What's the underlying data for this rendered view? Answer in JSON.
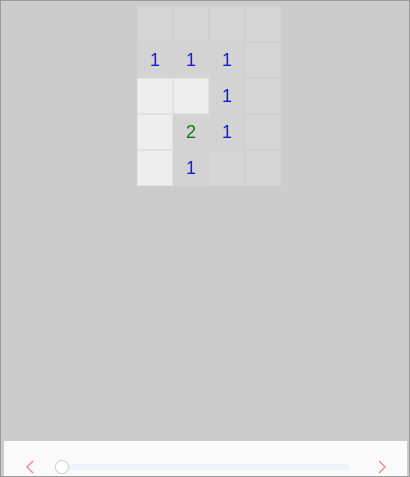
{
  "board": {
    "cols": 4,
    "rows": 5,
    "cells": [
      {
        "state": "hidden",
        "label": ""
      },
      {
        "state": "hidden",
        "label": ""
      },
      {
        "state": "hidden",
        "label": ""
      },
      {
        "state": "hidden",
        "label": ""
      },
      {
        "state": "revealed",
        "label": "1"
      },
      {
        "state": "revealed",
        "label": "1"
      },
      {
        "state": "revealed",
        "label": "1"
      },
      {
        "state": "hidden",
        "label": ""
      },
      {
        "state": "empty",
        "label": ""
      },
      {
        "state": "empty",
        "label": ""
      },
      {
        "state": "revealed",
        "label": "1"
      },
      {
        "state": "hidden",
        "label": ""
      },
      {
        "state": "empty",
        "label": ""
      },
      {
        "state": "revealed",
        "label": "2"
      },
      {
        "state": "revealed",
        "label": "1"
      },
      {
        "state": "hidden",
        "label": ""
      },
      {
        "state": "empty",
        "label": ""
      },
      {
        "state": "revealed",
        "label": "1"
      },
      {
        "state": "hidden",
        "label": ""
      },
      {
        "state": "hidden",
        "label": ""
      }
    ]
  },
  "navigation": {
    "prev_icon": "chevron-left-icon",
    "next_icon": "chevron-right-icon",
    "slider_position": 0,
    "accent_color": "#e98a8a"
  },
  "colors": {
    "number_1": "#1a1ad4",
    "number_2": "#0f7a0f",
    "background": "#cccccc"
  }
}
